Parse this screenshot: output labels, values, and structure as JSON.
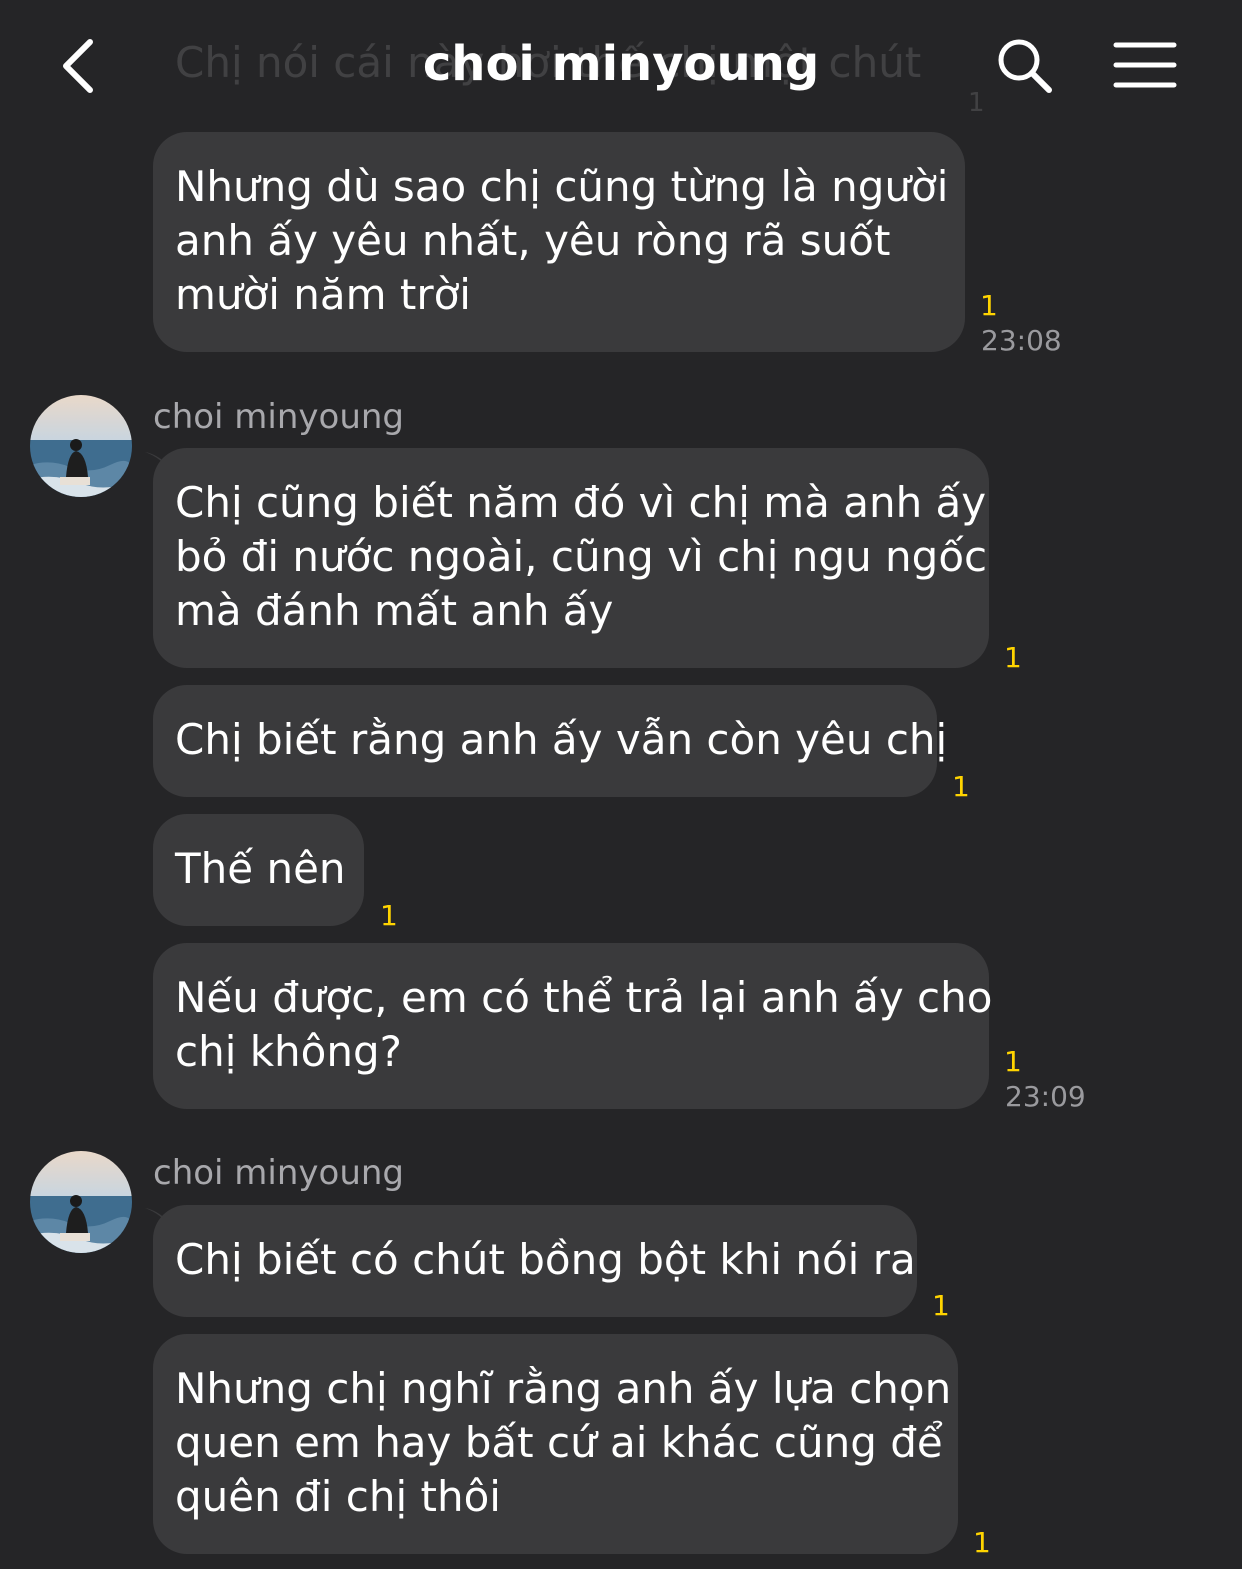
{
  "header": {
    "title": "choi minyoung",
    "faded_preview": "Chị nói cái này hơi thế chị một chút",
    "faded_count": "1",
    "back_icon": "chevron-left-icon",
    "search_icon": "search-icon",
    "menu_icon": "hamburger-menu-icon"
  },
  "messages": [
    {
      "lines": [
        "Nhưng dù sao chị cũng từng là người",
        "anh ấy yêu nhất, yêu ròng rã suốt",
        "mười năm trời"
      ],
      "count": "1",
      "time": "23:08"
    },
    {
      "sender": "choi minyoung"
    },
    {
      "lines": [
        "Chị cũng biết năm đó vì chị mà anh ấy",
        "bỏ đi nước ngoài, cũng vì chị ngu ngốc",
        "mà đánh mất anh ấy"
      ],
      "count": "1"
    },
    {
      "lines": [
        "Chị biết rằng anh ấy vẫn còn yêu chị"
      ],
      "count": "1"
    },
    {
      "lines": [
        "Thế nên"
      ],
      "count": "1"
    },
    {
      "lines": [
        "Nếu được, em có thể trả lại anh ấy cho",
        "chị không?"
      ],
      "count": "1",
      "time": "23:09"
    },
    {
      "sender": "choi minyoung"
    },
    {
      "lines": [
        "Chị biết có chút bồng bột khi nói ra"
      ],
      "count": "1"
    },
    {
      "lines": [
        "Nhưng chị nghĩ rằng anh ấy lựa chọn",
        "quen em hay bất cứ ai khác cũng để",
        "quên đi chị thôi"
      ],
      "count": "1"
    }
  ],
  "colors": {
    "background": "#252527",
    "bubble": "#3a3a3c",
    "unread_count": "#ffd400",
    "timestamp": "#9a9a9e"
  }
}
